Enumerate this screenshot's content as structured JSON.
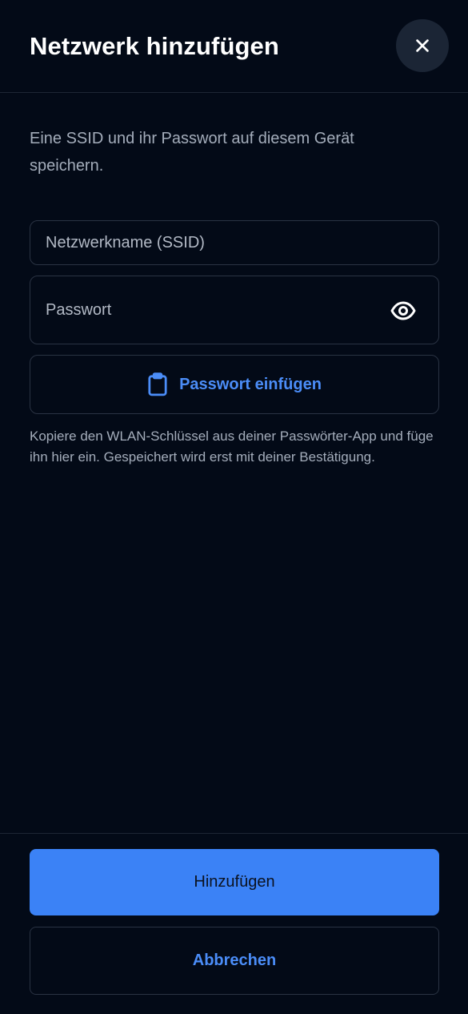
{
  "header": {
    "title": "Netzwerk hinzufügen",
    "close_icon": "close-icon"
  },
  "intro": {
    "text": "Eine SSID und ihr Passwort auf diesem Gerät speichern."
  },
  "form": {
    "ssid": {
      "placeholder": "Netzwerkname (SSID)",
      "value": ""
    },
    "password": {
      "placeholder": "Passwort",
      "value": "",
      "toggle_icon": "eye-icon"
    },
    "paste": {
      "label": "Passwort einfügen",
      "icon": "clipboard-icon"
    },
    "hint": "Kopiere den WLAN-Schlüssel aus deiner Passwörter-App und füge ihn hier ein. Gespeichert wird erst mit deiner Bestätigung."
  },
  "footer": {
    "submit_label": "Hinzufügen",
    "cancel_label": "Abbrechen"
  },
  "colors": {
    "background": "#030a17",
    "accent": "#3b82f6",
    "accent_text": "#4b8df8",
    "border": "#2a3343",
    "muted_text": "#a4adbb"
  }
}
